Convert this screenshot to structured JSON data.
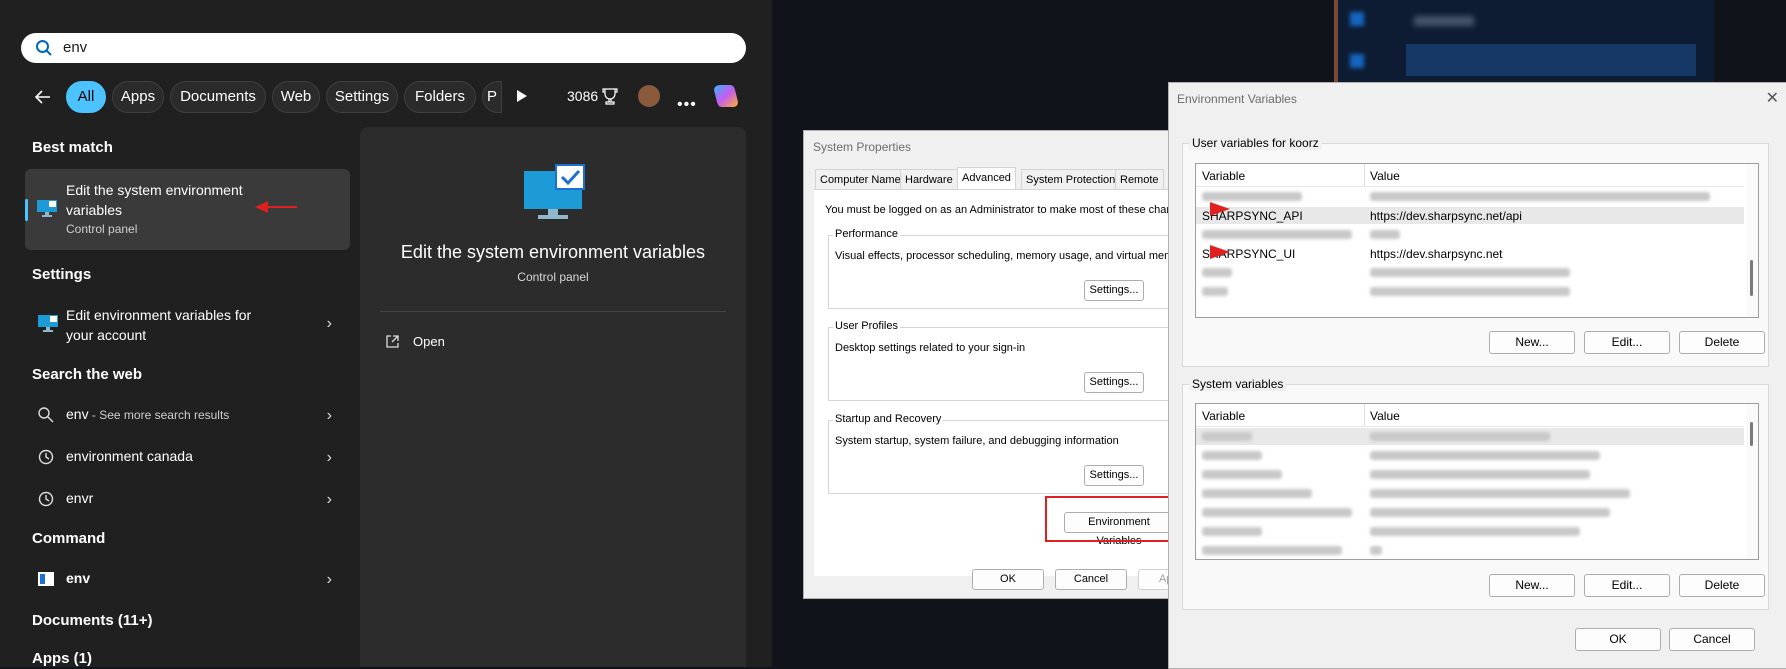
{
  "search": {
    "query": "env",
    "filters": [
      "All",
      "Apps",
      "Documents",
      "Web",
      "Settings",
      "Folders",
      "P"
    ],
    "points": "3086"
  },
  "best_match": {
    "heading": "Best match",
    "title": "Edit the system environment variables",
    "subtitle": "Control panel"
  },
  "settings": {
    "heading": "Settings",
    "item": "Edit environment variables for your account"
  },
  "web": {
    "heading": "Search the web",
    "items": [
      {
        "label": "env",
        "suffix": " - See more search results"
      },
      {
        "label": "environment canada",
        "suffix": ""
      },
      {
        "label": "envr",
        "suffix": ""
      }
    ]
  },
  "command": {
    "heading": "Command",
    "item": "env"
  },
  "documents_heading": "Documents (11+)",
  "apps_heading": "Apps (1)",
  "preview": {
    "title": "Edit the system environment variables",
    "subtitle": "Control panel",
    "open_label": "Open"
  },
  "system_properties": {
    "title": "System Properties",
    "tabs": [
      "Computer Name",
      "Hardware",
      "Advanced",
      "System Protection",
      "Remote"
    ],
    "admin_note": "You must be logged on as an Administrator to make most of these chang",
    "performance": {
      "label": "Performance",
      "desc": "Visual effects, processor scheduling, memory usage, and virtual memory"
    },
    "user_profiles": {
      "label": "User Profiles",
      "desc": "Desktop settings related to your sign-in"
    },
    "startup": {
      "label": "Startup and Recovery",
      "desc": "System startup, system failure, and debugging information"
    },
    "settings_button": "Settings...",
    "env_button": "Environment Variables",
    "ok": "OK",
    "cancel": "Cancel",
    "apply": "Ap"
  },
  "env_dialog": {
    "title": "Environment Variables",
    "user_group": "User variables for koorz",
    "system_group": "System variables",
    "col_variable": "Variable",
    "col_value": "Value",
    "user_vars": [
      {
        "name": "SHARPSYNC_API",
        "value": "https://dev.sharpsync.net/api"
      },
      {
        "name": "SHARPSYNC_UI",
        "value": "https://dev.sharpsync.net"
      }
    ],
    "new": "New...",
    "edit": "Edit...",
    "delete": "Delete",
    "ok": "OK",
    "cancel": "Cancel"
  },
  "colors": {
    "accent": "#4cc2ff",
    "annotation": "#e02020",
    "panel": "#202020"
  }
}
